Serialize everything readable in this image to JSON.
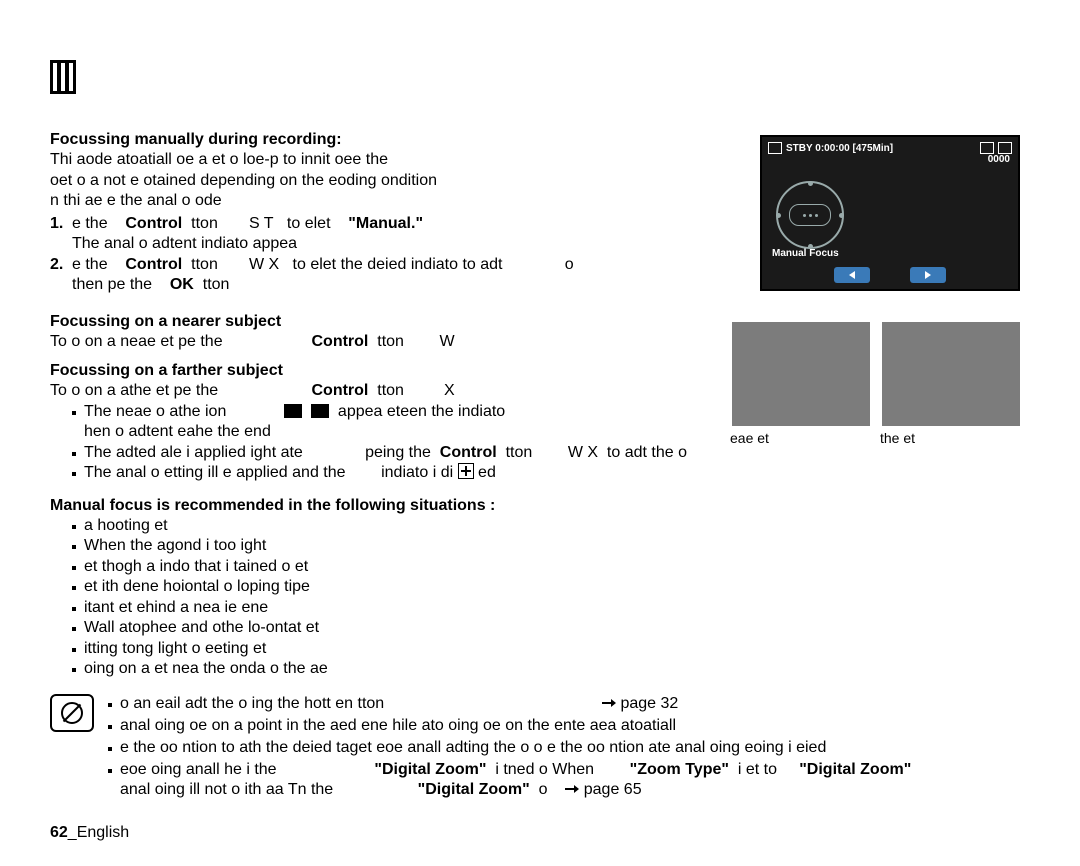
{
  "heading1": "Focussing manually during recording:",
  "intro_l1": "Thi aode atoatiall oe a et o loe-p to innit oee the",
  "intro_l2": "oet o a not e otained depending on the eoding ondition",
  "intro_l3": "n thi ae e the anal o ode",
  "step1_num": "1.",
  "step1_a": "e the",
  "step1_ctrl": "Control",
  "step1_tton": "tton",
  "step1_st": "S   T",
  "step1_toelet": "to elet",
  "step1_manual": "\"Manual.\"",
  "step1_sub": "The anal o adtent indiato appea",
  "step2_num": "2.",
  "step2_a": "e the",
  "step2_ctrl": "Control",
  "step2_tton": "tton",
  "step2_wx": "W   X",
  "step2_rest": "to elet the deied indiato to adt",
  "step2_o": "o",
  "step2_then": "then pe the",
  "step2_ok": "OK",
  "step2_tton2": "tton",
  "heading2": "Focussing on a nearer subject",
  "near_l1_a": "To o on a neae et pe the",
  "near_l1_ctrl": "Control",
  "near_l1_tton": "tton",
  "near_l1_w": "W",
  "heading3": "Focussing on a farther subject",
  "far_l1_a": "To o on a athe et pe the",
  "far_l1_ctrl": "Control",
  "far_l1_tton": "tton",
  "far_l1_x": "X",
  "far_b1_a": "The neae o athe ion",
  "far_b1_b": "appea eteen the indiato",
  "far_b1_c": "hen o adtent eahe the end",
  "far_b2_a": "The adted ale i applied ight ate",
  "far_b2_b": "peing the",
  "far_b2_ctrl": "Control",
  "far_b2_tton": "tton",
  "far_b2_wx": "W   X",
  "far_b2_rest": "to adt the o",
  "far_b3_a": "The anal o etting ill e applied and the",
  "far_b3_b": "indiato i di",
  "far_b3_c": "ed",
  "heading4": "Manual focus is recommended in the following situations :",
  "mf_items": [
    "a hooting et",
    "When the agond i too ight",
    "et thogh a indo that i tained o et",
    "et ith dene hoiontal o loping tipe",
    "itant et ehind a nea ie ene",
    "Wall atophee and othe lo-ontat et",
    "itting tong light o eeting et",
    "oing on a et nea the onda o the ae"
  ],
  "note1_a": "o an eail adt the o ing the hott en tton",
  "note1_b": "page 32",
  "note2": "anal oing oe on a point in the aed ene hile ato oing oe on the ente aea atoatiall",
  "note3": "e the oo ntion to ath the deied taget eoe anall adting the o  o e the oo ntion ate anal oing eoing i eied",
  "note4_a": "eoe oing anall he i the",
  "note4_dz1": "\"Digital Zoom\"",
  "note4_mid": "i tned o When",
  "note4_zt": "\"Zoom Type\"",
  "note4_iet": "i et to",
  "note4_dz2": "\"Digital Zoom\"",
  "note4_line2_a": "anal oing ill not o ith aa Tn the",
  "note4_line2_dz": "\"Digital Zoom\"",
  "note4_line2_o": "o",
  "note4_line2_pg": "page 65",
  "cam": {
    "status": "STBY 0:00:00 [475Min]",
    "row2": "0000",
    "label": "Manual Focus"
  },
  "cap_near": "eae et",
  "cap_far": "the et",
  "footer_page": "62",
  "footer_lang": "_English"
}
